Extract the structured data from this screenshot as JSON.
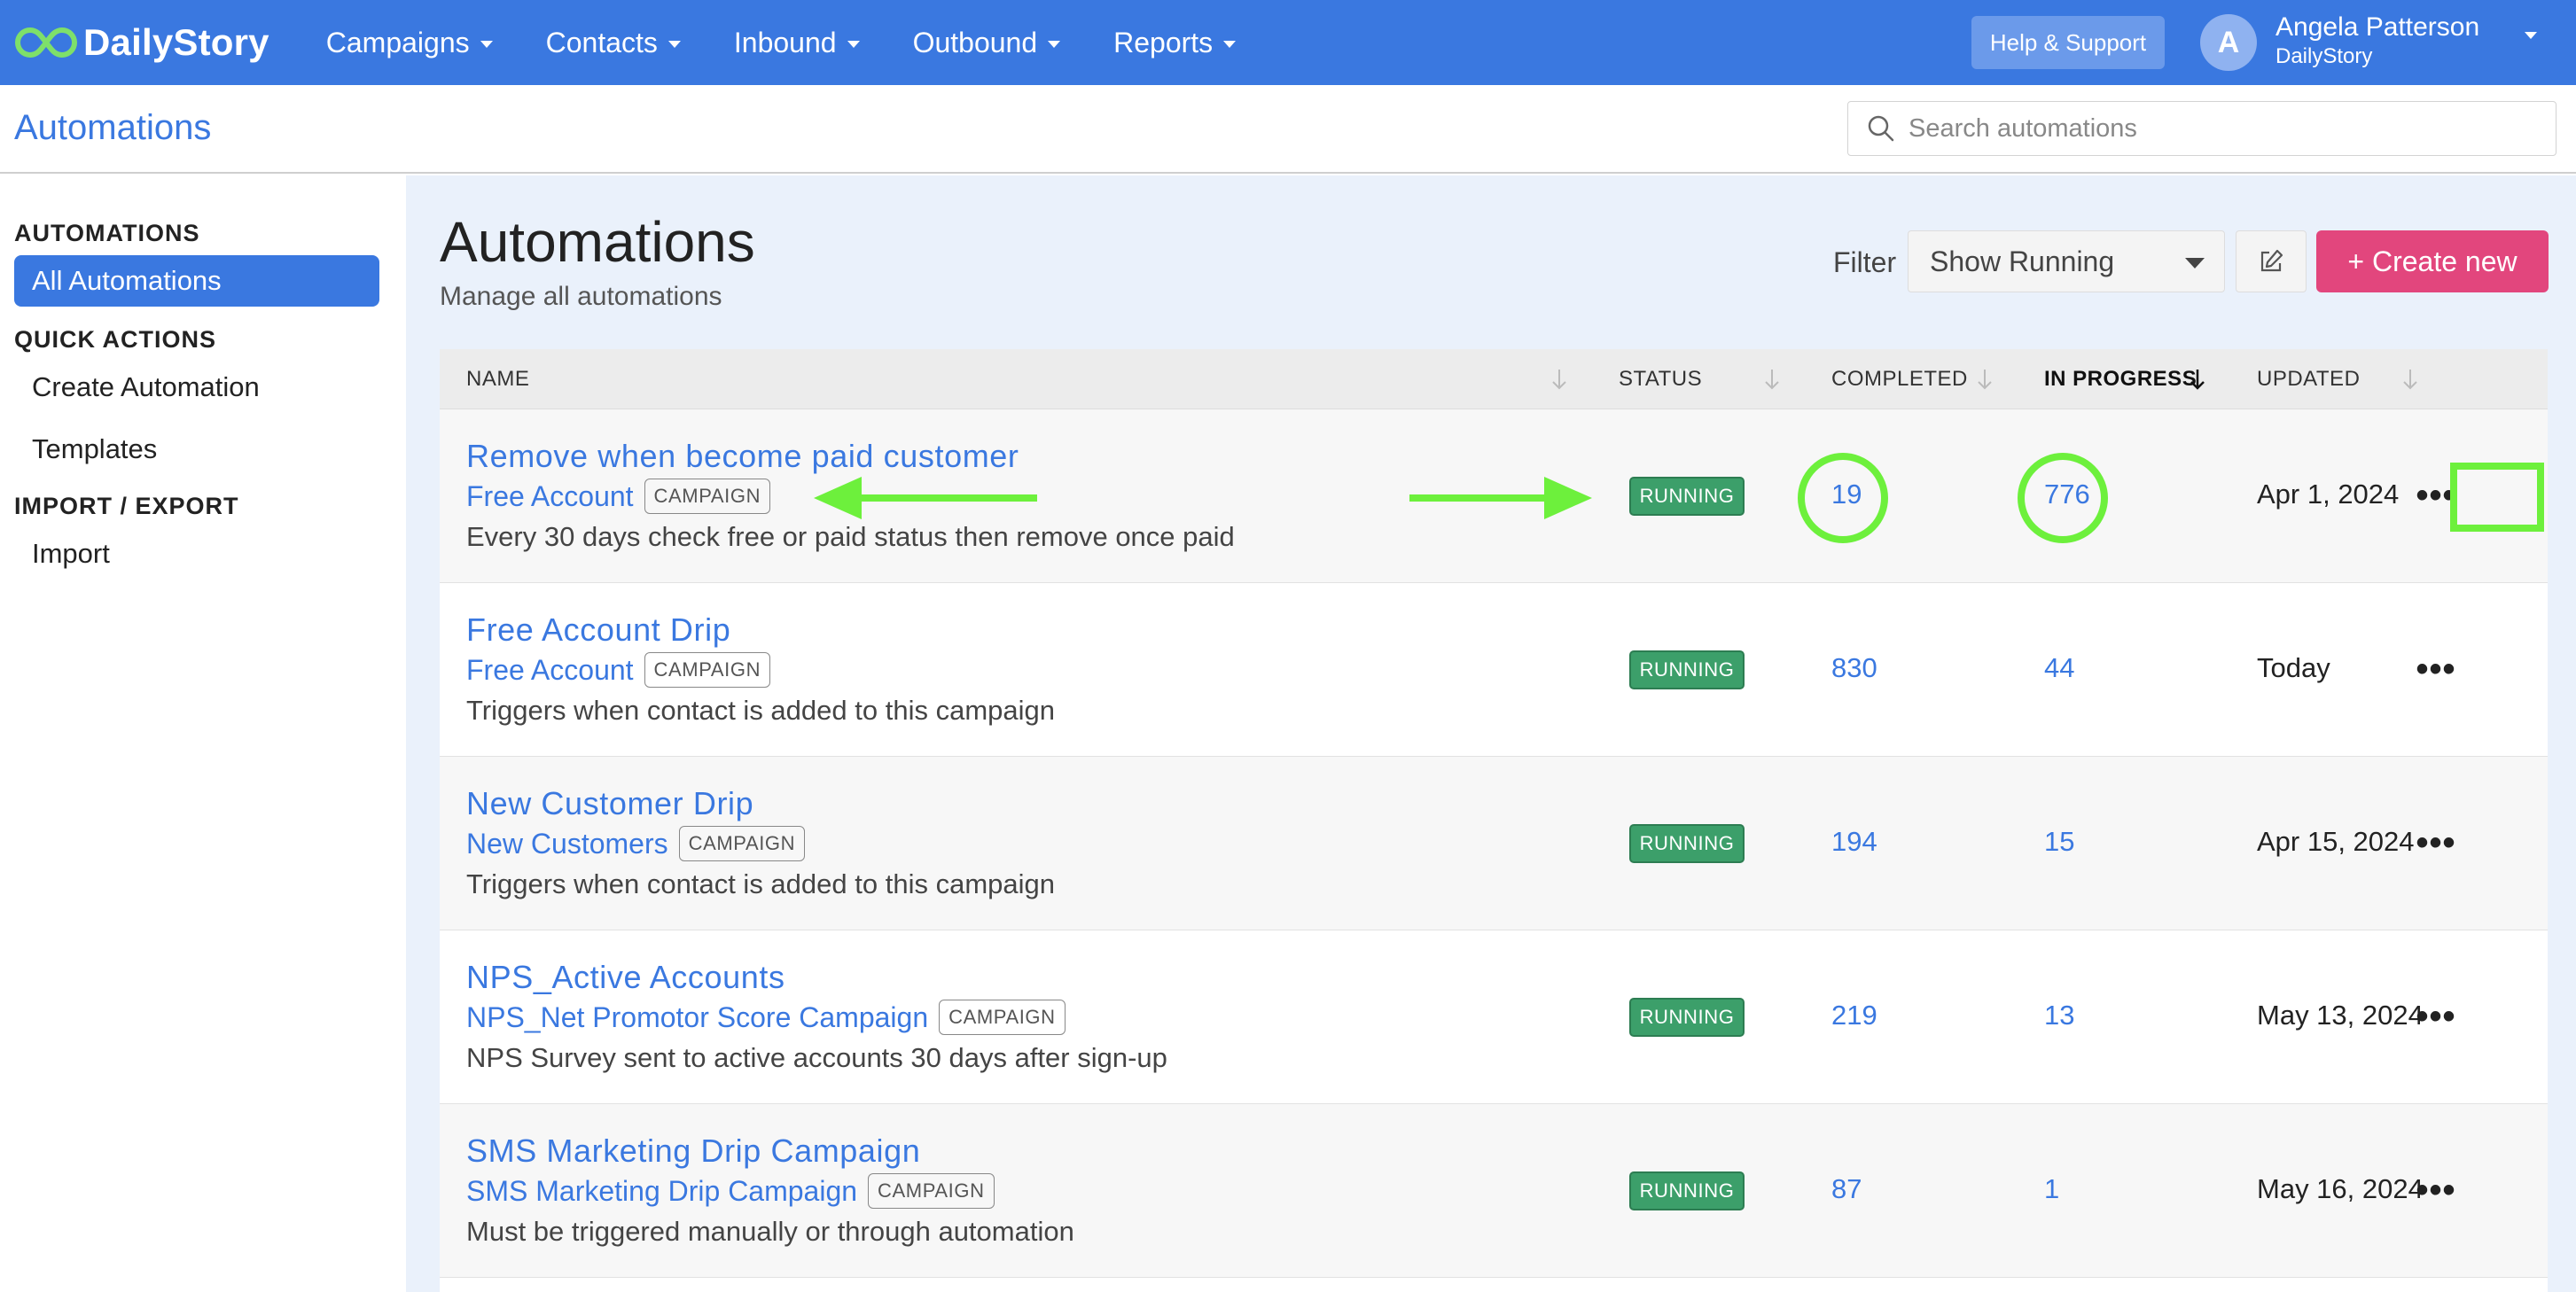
{
  "app": {
    "logo_text": "DailyStory",
    "nav": [
      {
        "label": "Campaigns"
      },
      {
        "label": "Contacts"
      },
      {
        "label": "Inbound"
      },
      {
        "label": "Outbound"
      },
      {
        "label": "Reports"
      }
    ],
    "help_label": "Help & Support",
    "user": {
      "initial": "A",
      "name": "Angela Patterson",
      "org": "DailyStory"
    }
  },
  "subheader": {
    "title": "Automations",
    "search_placeholder": "Search automations"
  },
  "sidebar": {
    "sections": [
      {
        "title": "AUTOMATIONS",
        "items": [
          {
            "label": "All Automations",
            "active": true
          }
        ]
      },
      {
        "title": "QUICK ACTIONS",
        "items": [
          {
            "label": "Create Automation"
          },
          {
            "label": "Templates"
          }
        ]
      },
      {
        "title": "IMPORT / EXPORT",
        "items": [
          {
            "label": "Import"
          }
        ]
      }
    ]
  },
  "main": {
    "title": "Automations",
    "subtitle": "Manage all automations",
    "filter_label": "Filter",
    "filter_value": "Show Running",
    "create_label": "+ Create new"
  },
  "table": {
    "columns": [
      "NAME",
      "STATUS",
      "COMPLETED",
      "IN PROGRESS",
      "UPDATED"
    ],
    "rows": [
      {
        "name": "Remove when become paid customer",
        "campaign": "Free Account",
        "badge": "CAMPAIGN",
        "desc": "Every 30 days check free or paid status then remove once paid",
        "status": "RUNNING",
        "completed": "19",
        "in_progress": "776",
        "updated": "Apr 1, 2024"
      },
      {
        "name": "Free Account Drip",
        "campaign": "Free Account",
        "badge": "CAMPAIGN",
        "desc": "Triggers when contact is added to this campaign",
        "status": "RUNNING",
        "completed": "830",
        "in_progress": "44",
        "updated": "Today"
      },
      {
        "name": "New Customer Drip",
        "campaign": "New Customers",
        "badge": "CAMPAIGN",
        "desc": "Triggers when contact is added to this campaign",
        "status": "RUNNING",
        "completed": "194",
        "in_progress": "15",
        "updated": "Apr 15, 2024"
      },
      {
        "name": "NPS_Active Accounts",
        "campaign": "NPS_Net Promotor Score Campaign",
        "badge": "CAMPAIGN",
        "desc": "NPS Survey sent to active accounts 30 days after sign-up",
        "status": "RUNNING",
        "completed": "219",
        "in_progress": "13",
        "updated": "May 13, 2024"
      },
      {
        "name": "SMS Marketing Drip Campaign",
        "campaign": "SMS Marketing Drip Campaign",
        "badge": "CAMPAIGN",
        "desc": "Must be triggered manually or through automation",
        "status": "RUNNING",
        "completed": "87",
        "in_progress": "1",
        "updated": "May 16, 2024"
      }
    ],
    "more_glyph": "•••"
  },
  "colors": {
    "brand": "#3a78e0",
    "create": "#e2467d",
    "running": "#3c9f6a",
    "annotation": "#6df03c"
  }
}
